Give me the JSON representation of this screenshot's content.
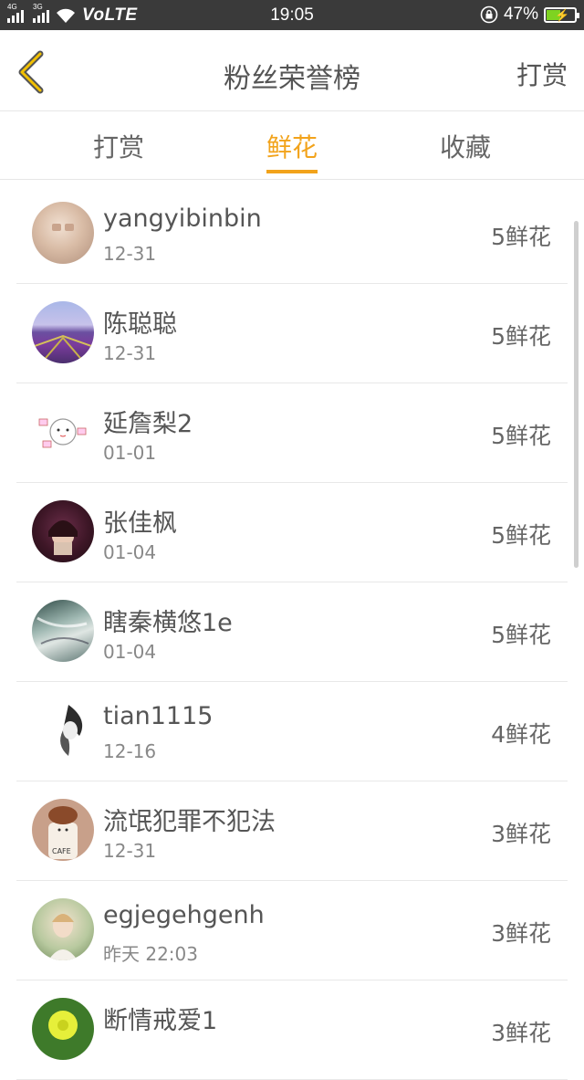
{
  "status_bar": {
    "net1": "4G",
    "net2": "3G",
    "volte": "VoLTE",
    "time": "19:05",
    "battery_text": "47%",
    "battery_level": 0.47,
    "icons": [
      "signal-icon",
      "wifi-icon",
      "rotation-lock-icon",
      "battery-icon"
    ]
  },
  "header": {
    "title": "粉丝荣誉榜",
    "right_label": "打赏",
    "back_icon": "chevron-left-icon",
    "accent": "#f2c000"
  },
  "tabs": [
    {
      "label": "打赏",
      "active": false
    },
    {
      "label": "鲜花",
      "active": true
    },
    {
      "label": "收藏",
      "active": false
    }
  ],
  "accent_color": "#f2a31b",
  "list": [
    {
      "name": "yangyibinbin",
      "date": "12-31",
      "count": "5鲜花"
    },
    {
      "name": "陈聪聪",
      "date": "12-31",
      "count": "5鲜花"
    },
    {
      "name": "延詹梨2",
      "date": "01-01",
      "count": "5鲜花"
    },
    {
      "name": "张佳枫",
      "date": "01-04",
      "count": "5鲜花"
    },
    {
      "name": "瞎秦横悠1e",
      "date": "01-04",
      "count": "5鲜花"
    },
    {
      "name": "tian1115",
      "date": "12-16",
      "count": "4鲜花"
    },
    {
      "name": "流氓犯罪不犯法",
      "date": "12-31",
      "count": "3鲜花"
    },
    {
      "name": "egjegehgenh",
      "date": "昨天 22:03",
      "count": "3鲜花"
    },
    {
      "name": "断情戒爱1",
      "date": "",
      "count": "3鲜花"
    }
  ]
}
